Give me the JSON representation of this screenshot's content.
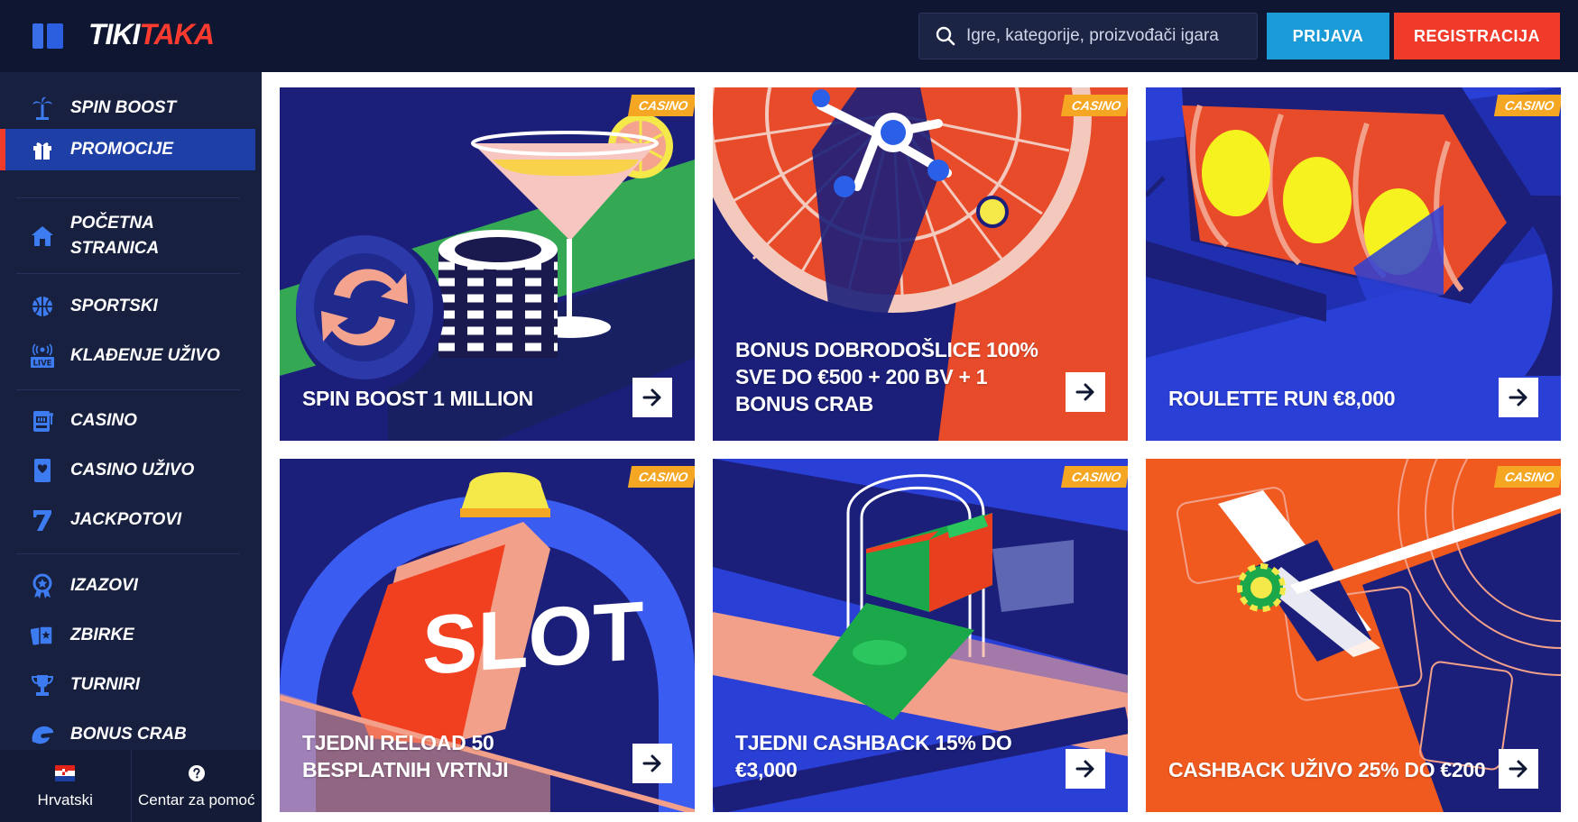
{
  "header": {
    "logo_part1": "TIKI",
    "logo_part2": "TAKA",
    "search_placeholder": "Igre, kategorije, proizvođači igara",
    "login_label": "PRIJAVA",
    "register_label": "REGISTRACIJA"
  },
  "sidebar": {
    "items": [
      {
        "label": "SPIN BOOST",
        "icon": "palm-tree-icon"
      },
      {
        "label": "PROMOCIJE",
        "icon": "gift-icon",
        "active": true
      },
      {
        "label": "POČETNA STRANICA",
        "icon": "home-icon"
      },
      {
        "label": "SPORTSKI",
        "icon": "basketball-icon"
      },
      {
        "label": "KLAĐENJE UŽIVO",
        "icon": "live-icon",
        "icon_text": "LIVE"
      },
      {
        "label": "CASINO",
        "icon": "slot-machine-icon"
      },
      {
        "label": "CASINO UŽIVO",
        "icon": "playing-card-icon"
      },
      {
        "label": "JACKPOTOVI",
        "icon": "seven-icon"
      },
      {
        "label": "IZAZOVI",
        "icon": "medal-icon"
      },
      {
        "label": "ZBIRKE",
        "icon": "cards-collection-icon"
      },
      {
        "label": "TURNIRI",
        "icon": "trophy-icon"
      },
      {
        "label": "BONUS CRAB",
        "icon": "crab-claw-icon"
      }
    ],
    "footer": {
      "language_label": "Hrvatski",
      "help_label": "Centar za pomoć"
    }
  },
  "promotions": [
    {
      "badge": "CASINO",
      "title": "SPIN BOOST 1 MILLION"
    },
    {
      "badge": "CASINO",
      "title": "BONUS DOBRODOŠLICE 100% SVE DO €500 + 200 BV + 1 BONUS CRAB"
    },
    {
      "badge": "CASINO",
      "title": "ROULETTE RUN €8,000"
    },
    {
      "badge": "CASINO",
      "title": "TJEDNI RELOAD 50 BESPLATNIH VRTNJI",
      "art_text": "SLOT"
    },
    {
      "badge": "CASINO",
      "title": "TJEDNI CASHBACK 15% DO €3,000"
    },
    {
      "badge": "CASINO",
      "title": "CASHBACK UŽIVO 25% DO €200"
    }
  ],
  "colors": {
    "header_bg": "#0f1632",
    "sidebar_bg": "#182040",
    "active_item_bg": "#1d3fa6",
    "accent_red": "#f03a2a",
    "accent_blue": "#1b9ad8",
    "badge_orange": "#f5a623"
  }
}
